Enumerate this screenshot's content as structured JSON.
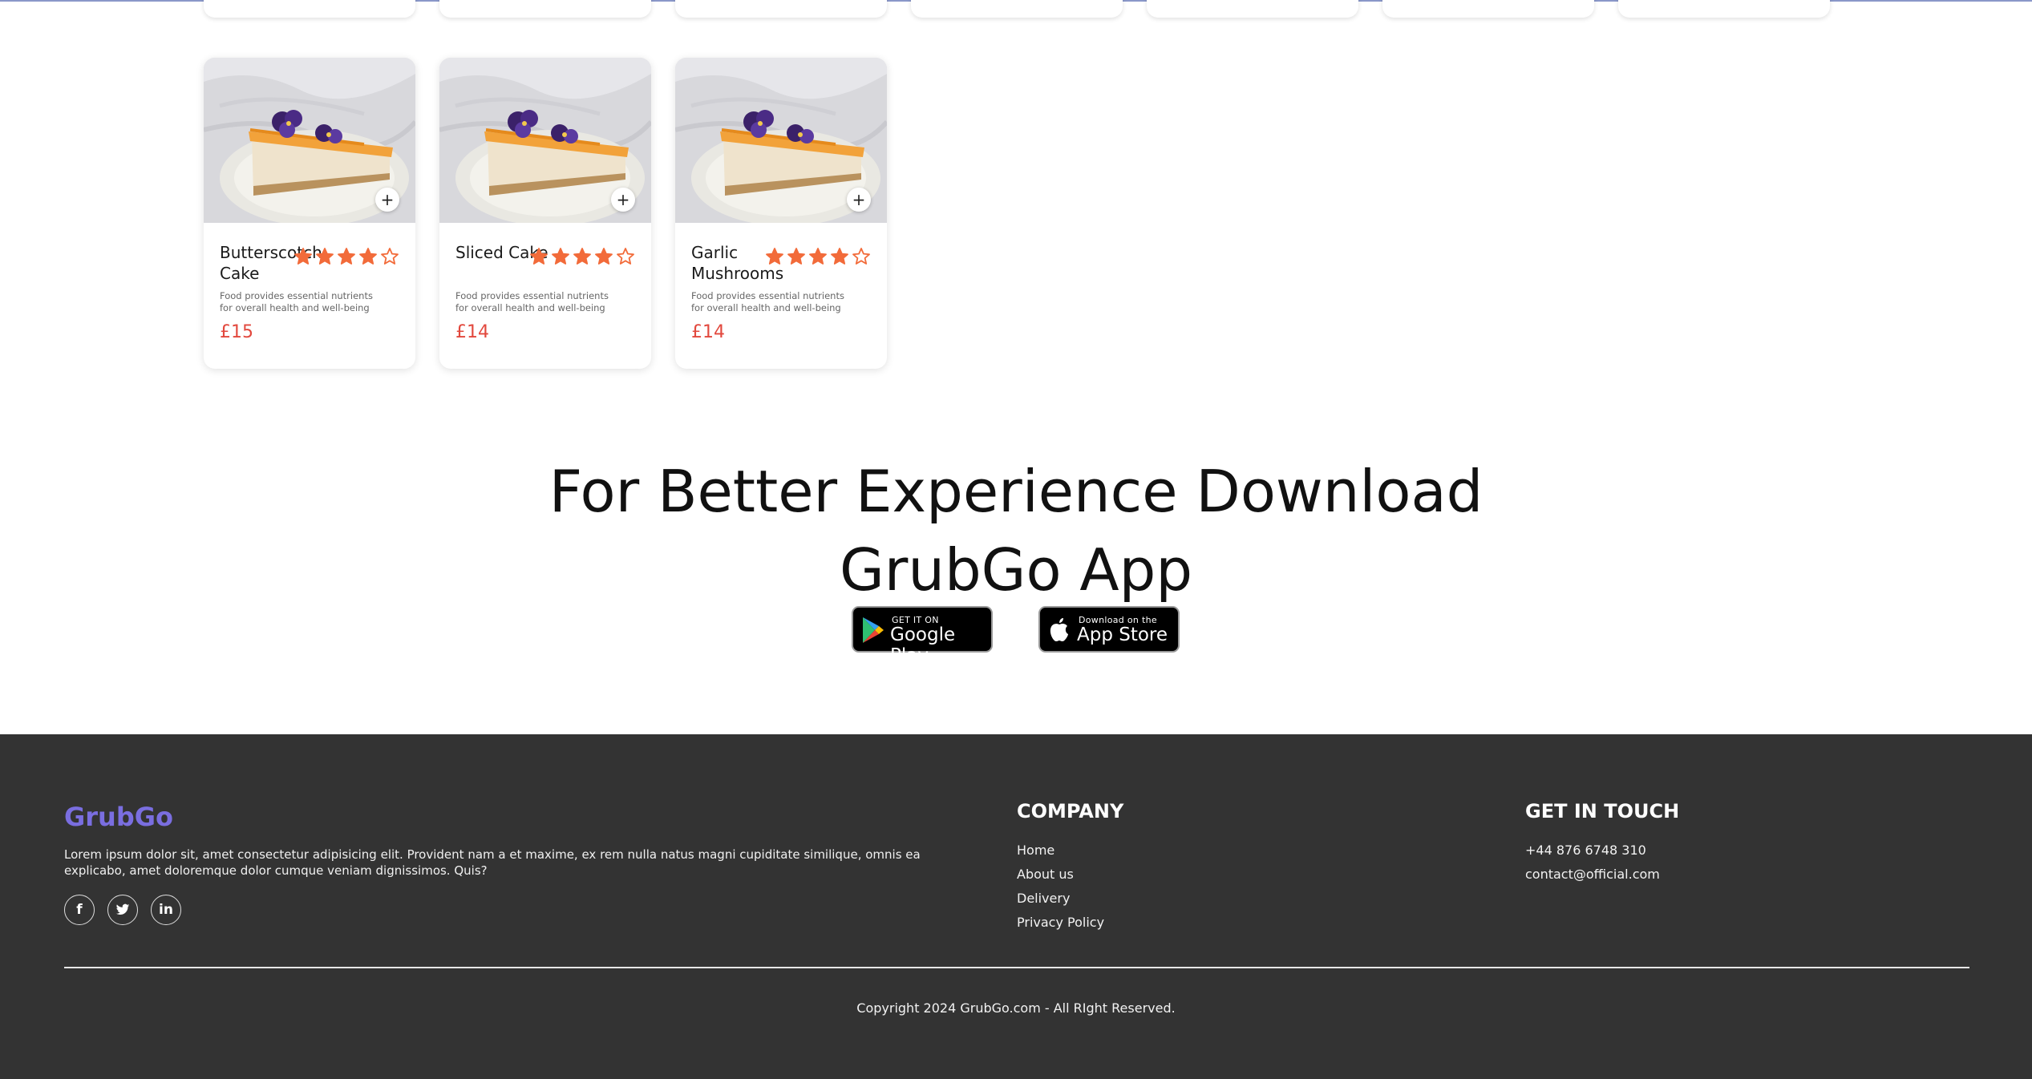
{
  "theme": {
    "accent": "#7a6ee0",
    "price": "#e2483d",
    "star": "#f26b3a",
    "footer_bg": "#333333"
  },
  "products": [
    {
      "name": "Butterscotch Cake",
      "description": "Food provides essential nutrients for overall health and well-being",
      "price": "£15",
      "rating": 4,
      "rating_max": 5
    },
    {
      "name": "Sliced Cake",
      "description": "Food provides essential nutrients for overall health and well-being",
      "price": "£14",
      "rating": 4,
      "rating_max": 5
    },
    {
      "name": "Garlic Mushrooms",
      "description": "Food provides essential nutrients for overall health and well-being",
      "price": "£14",
      "rating": 4,
      "rating_max": 5
    }
  ],
  "add_button_label": "+",
  "download": {
    "headline_line1": "For Better Experience Download",
    "headline_line2": "GrubGo App",
    "google_small": "GET IT ON",
    "google_big": "Google Play",
    "apple_small": "Download on the",
    "apple_big": "App Store"
  },
  "footer": {
    "brand": "GrubGo",
    "about": "Lorem ipsum dolor sit, amet consectetur adipisicing elit. Provident nam a et maxime, ex rem nulla natus magni cupiditate similique, omnis ea explicabo, amet doloremque dolor cumque veniam dignissimos. Quis?",
    "social_icons": [
      "facebook-icon",
      "twitter-icon",
      "linkedin-icon"
    ],
    "company_title": "COMPANY",
    "company_links": [
      "Home",
      "About us",
      "Delivery",
      "Privacy Policy"
    ],
    "contact_title": "GET IN TOUCH",
    "phone": "+44 876 6748 310",
    "email": "contact@official.com",
    "copyright": "Copyright 2024 GrubGo.com - All RIght Reserved."
  }
}
